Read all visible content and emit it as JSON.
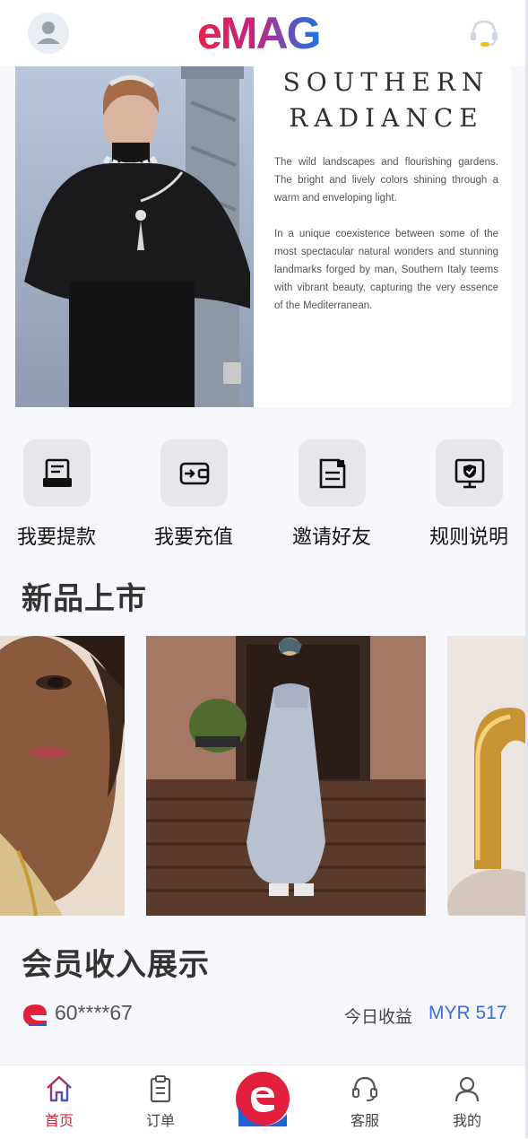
{
  "header": {
    "logo_text": "eMAG",
    "user_icon": "user-avatar-icon",
    "support_icon": "headset-icon"
  },
  "banner": {
    "title_line1": "SOUTHERN",
    "title_line2": "RADIANCE",
    "paragraph1": "The wild landscapes and flourishing gardens. The bright and lively colors shining through a warm and enveloping light.",
    "paragraph2": "In a unique coexistence between some of the most spectacular natural wonders and stunning landmarks forged by man, Southern Italy teems with vibrant beauty, capturing the very essence of the Mediterranean."
  },
  "actions": [
    {
      "label": "我要提款",
      "icon": "withdraw-tray-icon"
    },
    {
      "label": "我要充值",
      "icon": "wallet-recharge-icon"
    },
    {
      "label": "邀请好友",
      "icon": "invite-document-icon"
    },
    {
      "label": "规则说明",
      "icon": "rules-shield-monitor-icon"
    }
  ],
  "new_arrivals": {
    "title": "新品上市"
  },
  "member_income": {
    "title": "会员收入展示",
    "account": "60****67",
    "today_label": "今日收益",
    "today_value": "MYR 517"
  },
  "nav": [
    {
      "label": "首页",
      "icon": "home-icon",
      "active": true
    },
    {
      "label": "订单",
      "icon": "clipboard-icon",
      "active": false
    },
    {
      "label": "",
      "icon": "emag-e-center-icon",
      "active": false
    },
    {
      "label": "客服",
      "icon": "headset-icon",
      "active": false
    },
    {
      "label": "我的",
      "icon": "person-icon",
      "active": false
    }
  ],
  "colors": {
    "accent_red": "#e21f3c",
    "accent_blue": "#1e63d6",
    "income_value": "#3b6fd6",
    "nav_active": "#d9263f",
    "background": "#f6f7fb"
  }
}
